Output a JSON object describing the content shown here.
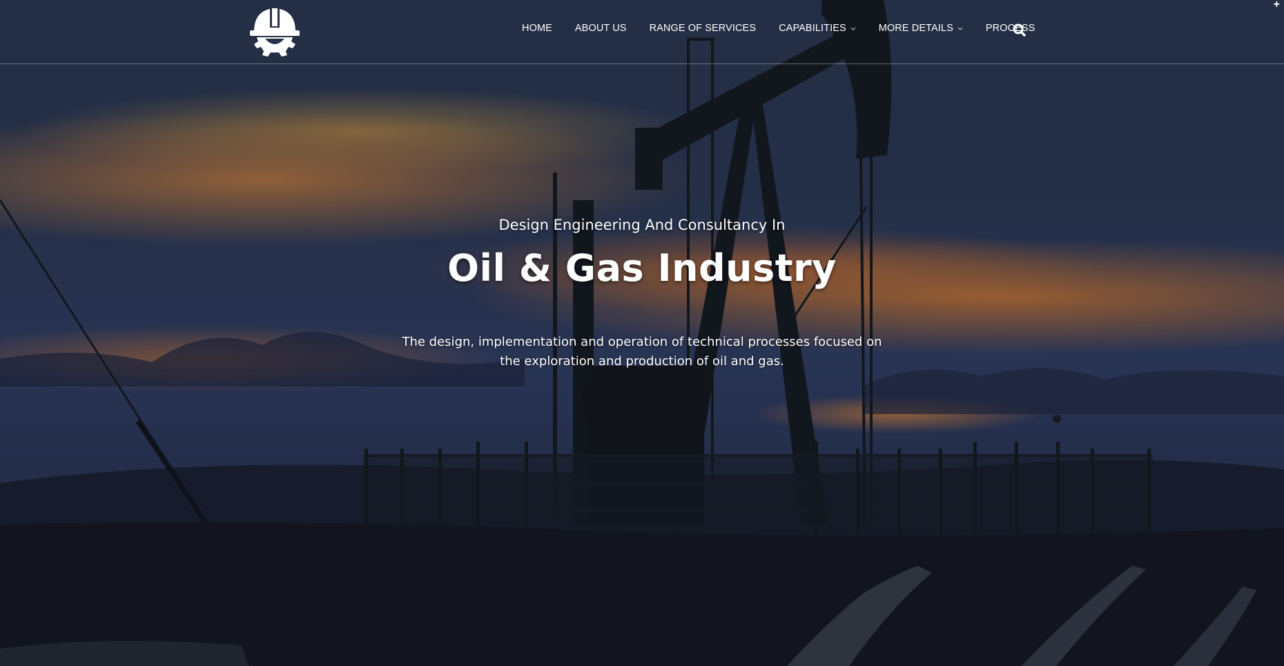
{
  "header": {
    "nav": [
      {
        "label": "HOME",
        "has_dropdown": false
      },
      {
        "label": "ABOUT US",
        "has_dropdown": false
      },
      {
        "label": "RANGE OF SERVICES",
        "has_dropdown": false
      },
      {
        "label": "CAPABILITIES",
        "has_dropdown": true
      },
      {
        "label": "MORE DETAILS",
        "has_dropdown": true
      },
      {
        "label": "PROCESS",
        "has_dropdown": false
      }
    ],
    "logo_icon": "hardhat-gear-icon",
    "search_icon": "search-icon",
    "corner_icon": "plus-icon",
    "corner_symbol": "+"
  },
  "hero": {
    "eyebrow": "Design Engineering And Consultancy In",
    "headline": "Oil & Gas Industry",
    "description": "The design, implementation and operation of technical processes focused on the exploration and production of oil and gas."
  },
  "colors": {
    "text": "#ffffff",
    "sky_dark": "#2d3a55",
    "sunset_orange": "#e08030",
    "silhouette": "#15181d"
  }
}
